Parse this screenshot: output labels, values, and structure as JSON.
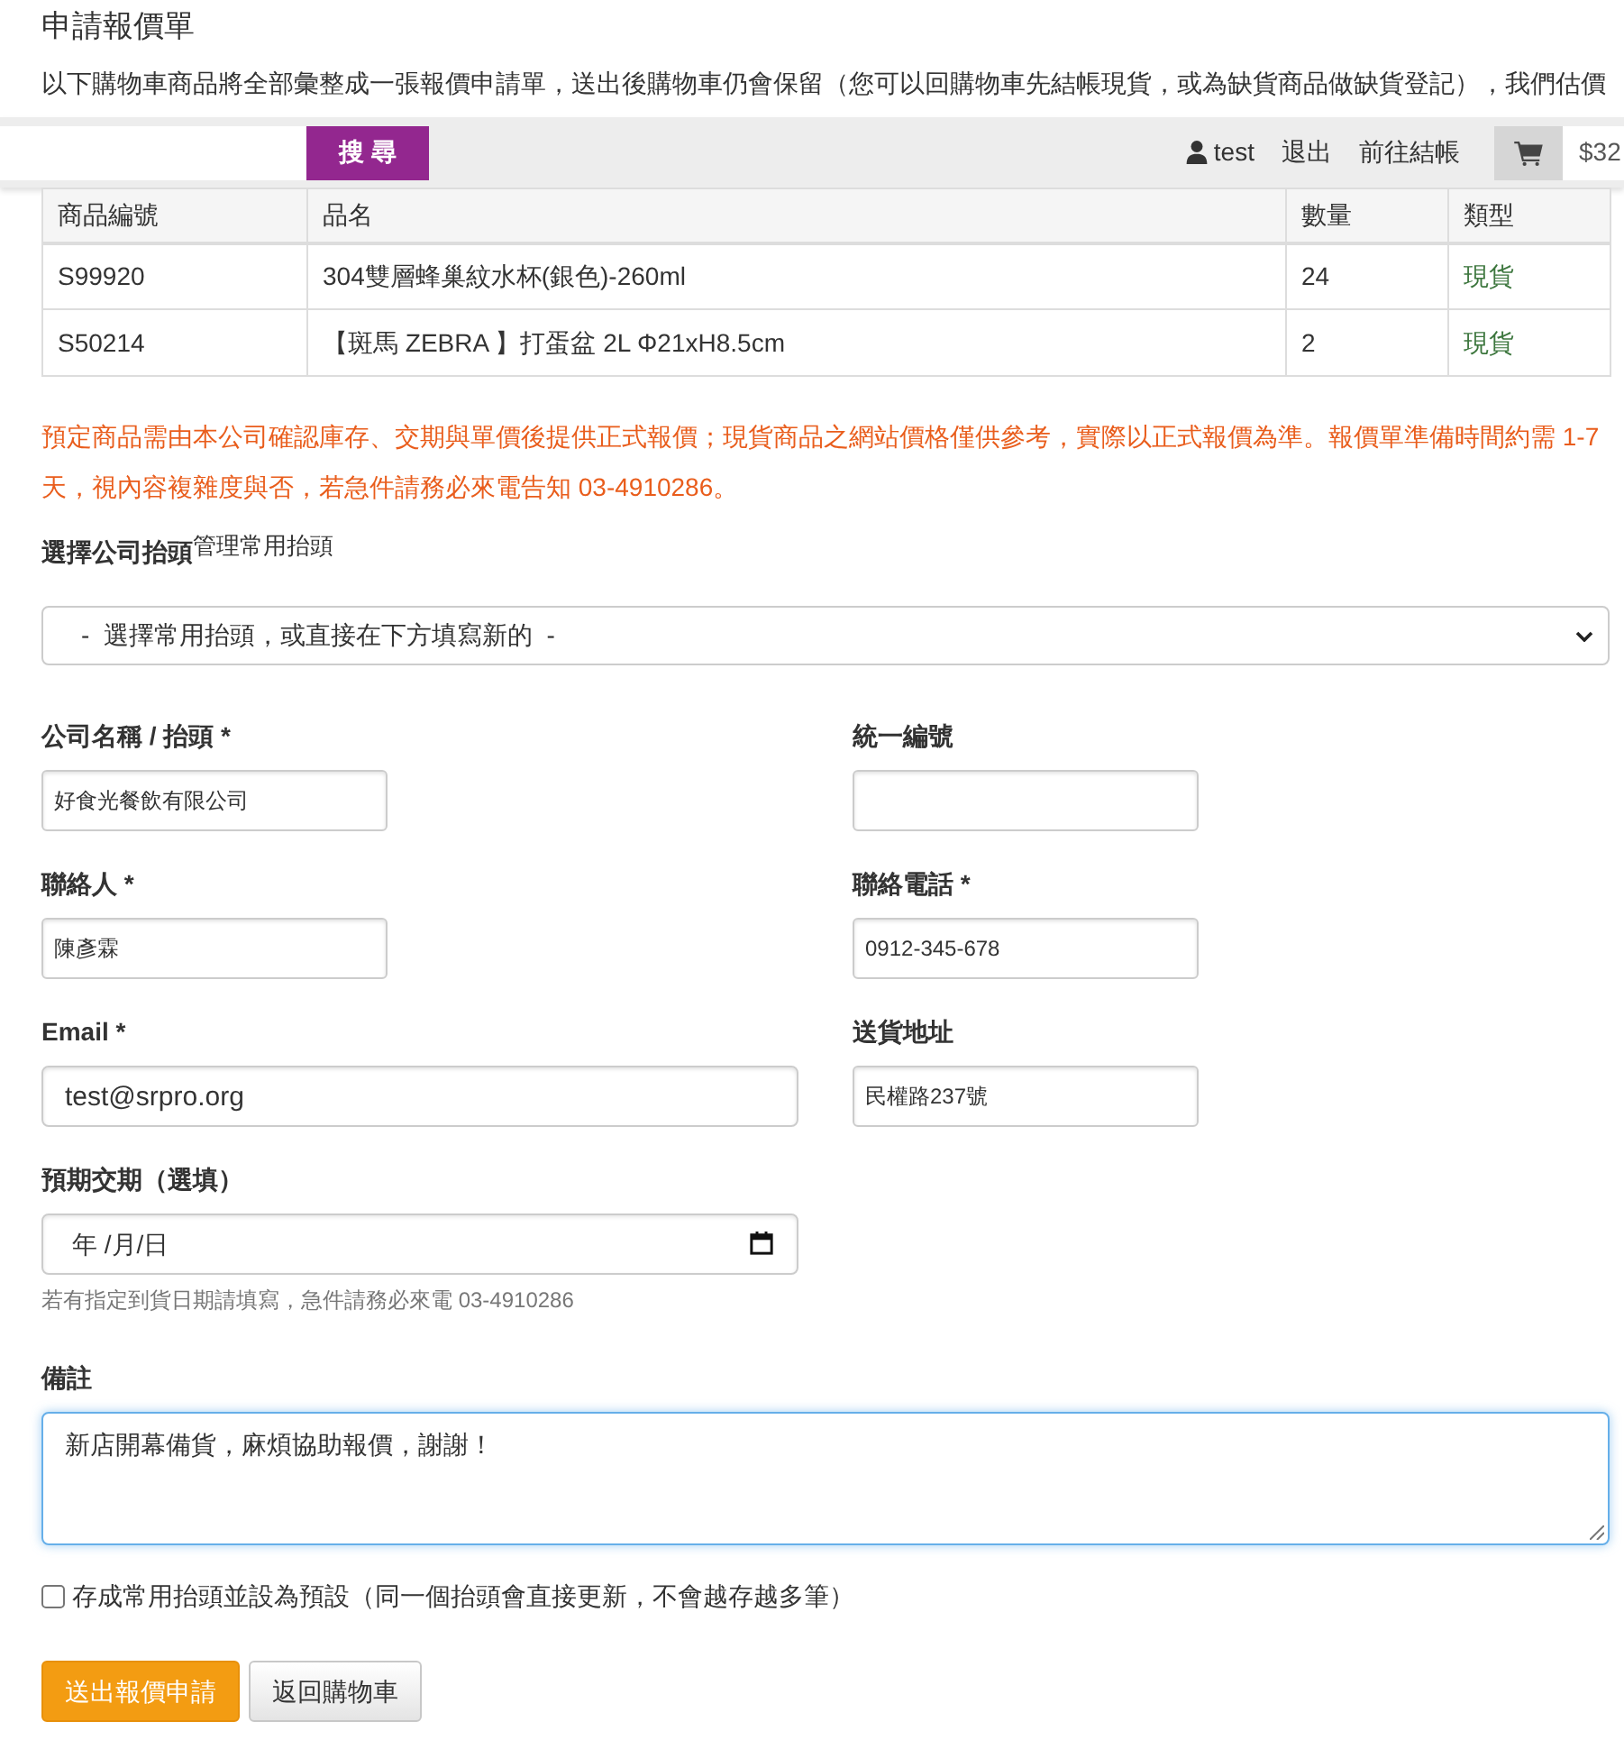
{
  "page": {
    "title": "申請報價單",
    "intro": "以下購物車商品將全部彙整成一張報價申請單，送出後購物車仍會保留（您可以回購物車先結帳現貨，或為缺貨商品做缺貨登記），我們估價"
  },
  "top_bar": {
    "search_button": "搜 尋",
    "user": "test",
    "links": [
      "退出",
      "前往結帳"
    ],
    "cart_total": "$32"
  },
  "table": {
    "columns": [
      "商品編號",
      "品名",
      "數量",
      "類型"
    ],
    "rows": [
      {
        "cells": [
          "S99920",
          "304雙層蜂巢紋水杯(銀色)-260ml",
          "24",
          "現貨"
        ]
      },
      {
        "cells": [
          "S50214",
          "【斑馬 ZEBRA 】打蛋盆 2L Φ21xH8.5cm",
          "2",
          "現貨"
        ]
      }
    ]
  },
  "notice": "預定商品需由本公司確認庫存、交期與單價後提供正式報價；現貨商品之網站價格僅供參考，實際以正式報價為準。報價單準備時間約需 1-7 天，視內容複雜度與否，若急件請務必來電告知 03-4910286。",
  "header_select": {
    "label": "選擇公司抬頭",
    "manage_link": "管理常用抬頭",
    "value": "-  選擇常用抬頭，或直接在下方填寫新的  -"
  },
  "fields": [
    {
      "label": "公司名稱 / 抬頭 *",
      "value": "好食光餐飲有限公司",
      "kind": "text"
    },
    {
      "label": "統一編號",
      "kind": "text"
    },
    {
      "label": "聯絡人 *",
      "value": "陳彥霖",
      "kind": "text"
    },
    {
      "label": "聯絡電話 *",
      "value": "0912-345-678",
      "kind": "text"
    },
    {
      "label": "Email *",
      "value": "test@srpro.org",
      "kind": "email"
    },
    {
      "label": "送貨地址",
      "value": "民權路237號",
      "kind": "text"
    }
  ],
  "delivery_date": {
    "label": "預期交期（選填）",
    "placeholder": "年 /月/日",
    "hint": "若有指定到貨日期請填寫，急件請務必來電 03-4910286"
  },
  "notes": {
    "label": "備註",
    "value": "新店開幕備貨，麻煩協助報價，謝謝！",
    "focused": true
  },
  "save_default": {
    "label": "存成常用抬頭並設為預設（同一個抬頭會直接更新，不會越存越多筆）",
    "checked": false
  },
  "buttons": [
    {
      "label": "送出報價申請",
      "kind": "primary"
    },
    {
      "label": "返回購物車",
      "kind": "default"
    }
  ]
}
